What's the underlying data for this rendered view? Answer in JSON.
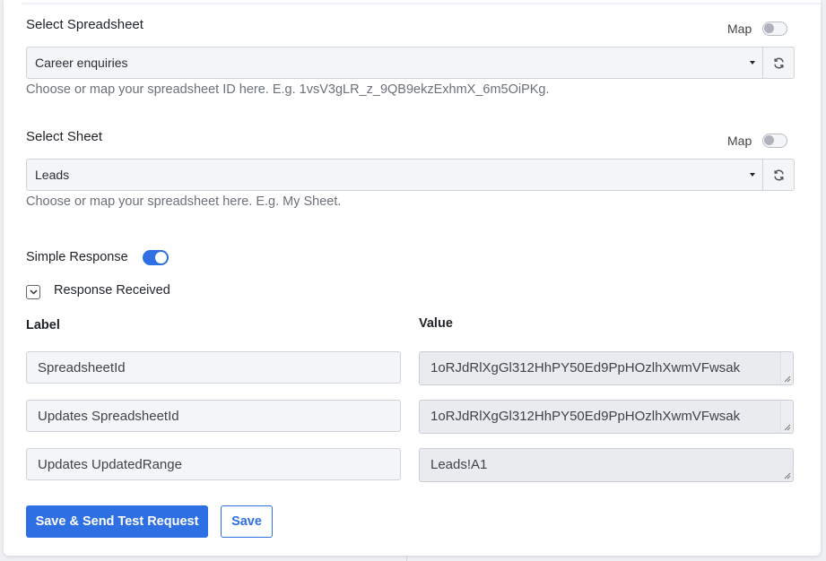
{
  "spreadsheet": {
    "title": "Select Spreadsheet",
    "map_label": "Map",
    "selected": "Career enquiries",
    "hint": "Choose or map your spreadsheet ID here. E.g. 1vsV3gLR_z_9QB9ekzExhmX_6m5OiPKg."
  },
  "sheet": {
    "title": "Select Sheet",
    "map_label": "Map",
    "selected": "Leads",
    "hint": "Choose or map your spreadsheet here. E.g. My Sheet."
  },
  "simple_response": {
    "label": "Simple Response",
    "enabled": true
  },
  "response_received": {
    "label": "Response Received",
    "expanded": true
  },
  "table": {
    "label_header": "Label",
    "value_header": "Value",
    "rows": [
      {
        "label": "SpreadsheetId",
        "value": "1oRJdRlXgGl312HhPY50Ed9PpHOzlhXwmVFwsak"
      },
      {
        "label": "Updates SpreadsheetId",
        "value": "1oRJdRlXgGl312HhPY50Ed9PpHOzlhXwmVFwsak"
      },
      {
        "label": "Updates UpdatedRange",
        "value": "Leads!A1"
      }
    ]
  },
  "actions": {
    "primary": "Save & Send Test Request",
    "secondary": "Save"
  },
  "colors": {
    "accent": "#2f6fe4"
  }
}
